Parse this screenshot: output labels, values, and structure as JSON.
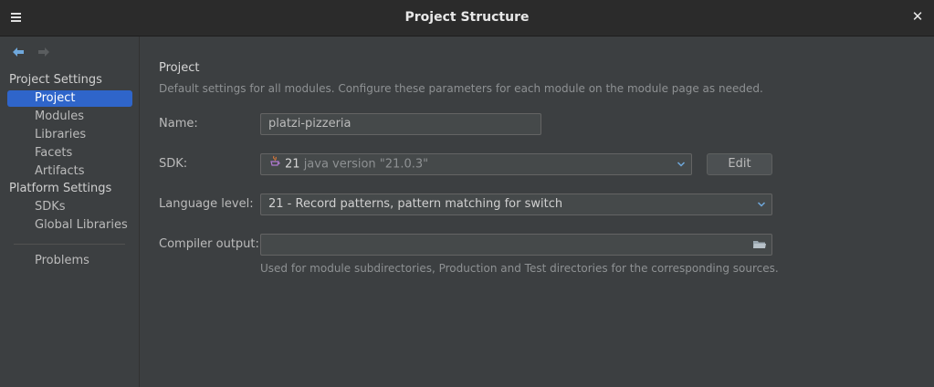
{
  "window": {
    "title": "Project Structure",
    "menu_icon": "hamburger-icon",
    "close_label": "✕"
  },
  "sidebar": {
    "project_settings_header": "Project Settings",
    "project_items": [
      {
        "label": "Project",
        "selected": true
      },
      {
        "label": "Modules"
      },
      {
        "label": "Libraries"
      },
      {
        "label": "Facets"
      },
      {
        "label": "Artifacts"
      }
    ],
    "platform_settings_header": "Platform Settings",
    "platform_items": [
      {
        "label": "SDKs"
      },
      {
        "label": "Global Libraries"
      }
    ],
    "problems_label": "Problems"
  },
  "main": {
    "heading": "Project",
    "description": "Default settings for all modules. Configure these parameters for each module on the module page as needed.",
    "name_label": "Name:",
    "name_value": "platzi-pizzeria",
    "sdk_label": "SDK:",
    "sdk_number": "21",
    "sdk_version": "java version \"21.0.3\"",
    "edit_button": "Edit",
    "language_level_label": "Language level:",
    "language_level_value": "21 - Record patterns, pattern matching for switch",
    "compiler_output_label": "Compiler output:",
    "compiler_output_value": "",
    "compiler_output_hint": "Used for module subdirectories, Production and Test directories for the corresponding sources."
  },
  "colors": {
    "selection": "#2f65ca",
    "background": "#3c3f41",
    "titlebar": "#2b2b2b"
  }
}
